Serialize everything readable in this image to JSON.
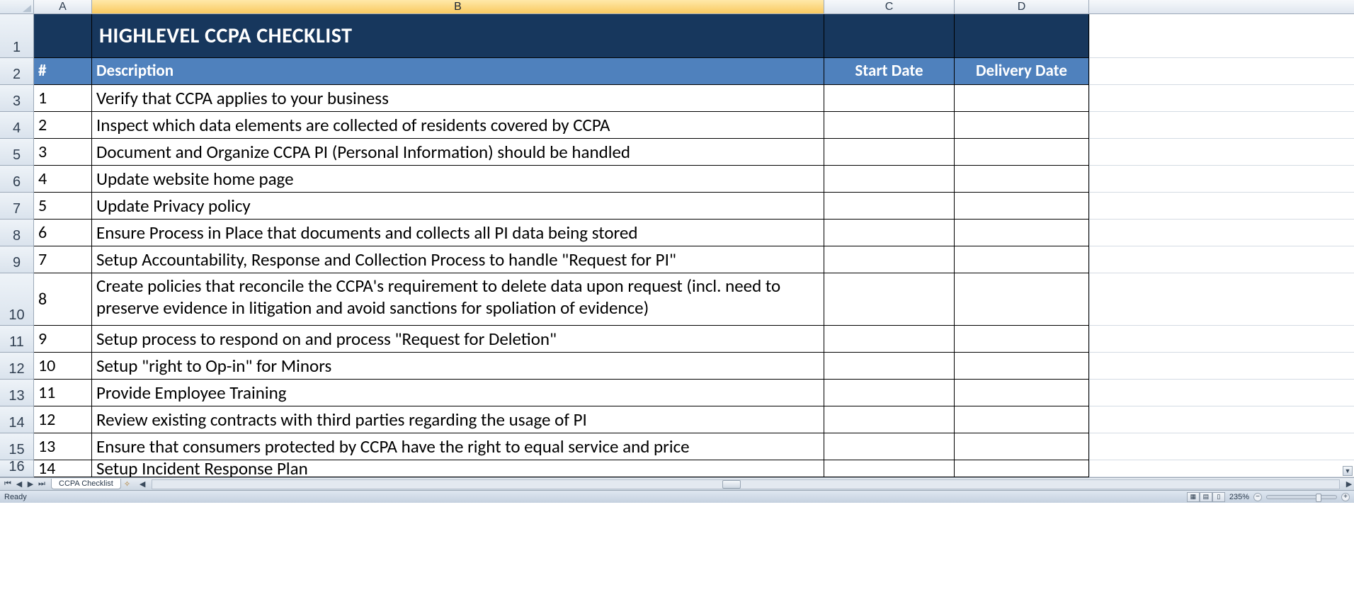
{
  "columns": [
    "A",
    "B",
    "C",
    "D"
  ],
  "active_column_index": 1,
  "title": "HIGHLEVEL CCPA CHECKLIST",
  "headers": {
    "num": "#",
    "desc": "Description",
    "start": "Start Date",
    "delivery": "Delivery Date"
  },
  "row_numbers": [
    "1",
    "2",
    "3",
    "4",
    "5",
    "6",
    "7",
    "8",
    "9",
    "10",
    "11",
    "12",
    "13",
    "14",
    "15",
    "16"
  ],
  "rows": [
    {
      "n": "1",
      "desc": "Verify that CCPA applies to your business",
      "start": "",
      "delivery": ""
    },
    {
      "n": "2",
      "desc": "Inspect which data elements are collected of residents covered by CCPA",
      "start": "",
      "delivery": ""
    },
    {
      "n": "3",
      "desc": "Document and Organize CCPA PI (Personal Information) should be handled",
      "start": "",
      "delivery": ""
    },
    {
      "n": "4",
      "desc": "Update website home page",
      "start": "",
      "delivery": ""
    },
    {
      "n": "5",
      "desc": "Update Privacy policy",
      "start": "",
      "delivery": ""
    },
    {
      "n": "6",
      "desc": "Ensure Process in Place that documents and collects all PI data being stored",
      "start": "",
      "delivery": ""
    },
    {
      "n": "7",
      "desc": "Setup Accountability, Response and Collection Process to handle \"Request for PI\"",
      "start": "",
      "delivery": ""
    },
    {
      "n": "8",
      "desc": "Create policies that reconcile the CCPA's requirement to delete data upon request (incl. need to preserve evidence in litigation and avoid sanctions for spoliation of evidence)",
      "start": "",
      "delivery": "",
      "tall": true
    },
    {
      "n": "9",
      "desc": "Setup process to respond on and process \"Request for Deletion\"",
      "start": "",
      "delivery": ""
    },
    {
      "n": "10",
      "desc": "Setup \"right to Op-in\" for Minors",
      "start": "",
      "delivery": ""
    },
    {
      "n": "11",
      "desc": "Provide Employee Training",
      "start": "",
      "delivery": ""
    },
    {
      "n": "12",
      "desc": "Review existing contracts with third parties regarding the usage of PI",
      "start": "",
      "delivery": ""
    },
    {
      "n": "13",
      "desc": "Ensure that consumers protected by CCPA have the right to equal service and price",
      "start": "",
      "delivery": ""
    },
    {
      "n": "14",
      "desc": "Setup Incident Response Plan",
      "start": "",
      "delivery": "",
      "partial": true
    }
  ],
  "sheet_tab": "CCPA Checklist",
  "status": {
    "ready": "Ready",
    "zoom": "235%"
  },
  "col_widths": {
    "A": 82,
    "B": 1034,
    "C": 184,
    "D": 190
  }
}
